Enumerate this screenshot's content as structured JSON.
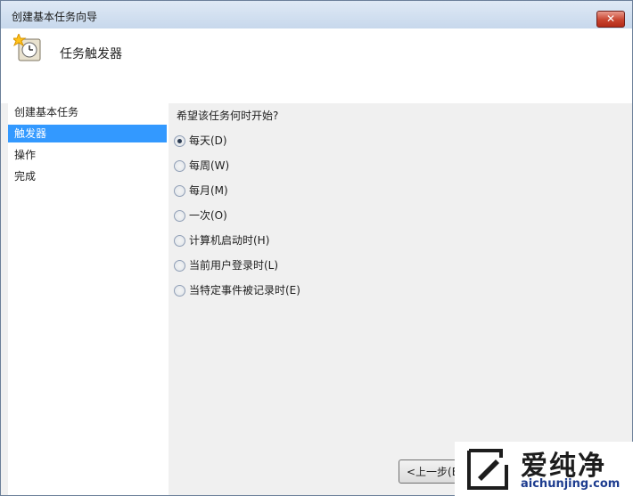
{
  "window": {
    "title": "创建基本任务向导",
    "close_label": "✕"
  },
  "header": {
    "title": "任务触发器",
    "icon": "task-scheduler-clock-icon"
  },
  "steps": [
    {
      "label": "创建基本任务",
      "active": false
    },
    {
      "label": "触发器",
      "active": true
    },
    {
      "label": "操作",
      "active": false
    },
    {
      "label": "完成",
      "active": false
    }
  ],
  "content": {
    "question": "希望该任务何时开始?",
    "options": [
      {
        "label": "每天(D)",
        "checked": true
      },
      {
        "label": "每周(W)",
        "checked": false
      },
      {
        "label": "每月(M)",
        "checked": false
      },
      {
        "label": "一次(O)",
        "checked": false
      },
      {
        "label": "计算机启动时(H)",
        "checked": false
      },
      {
        "label": "当前用户登录时(L)",
        "checked": false
      },
      {
        "label": "当特定事件被记录时(E)",
        "checked": false
      }
    ]
  },
  "footer": {
    "back_label": "<上一步(B"
  },
  "watermark": {
    "name": "爱纯净",
    "site": "aichunjing.com"
  },
  "colors": {
    "selection": "#3399ff",
    "close": "#c8442f",
    "watermark_site": "#1d3c8f"
  }
}
